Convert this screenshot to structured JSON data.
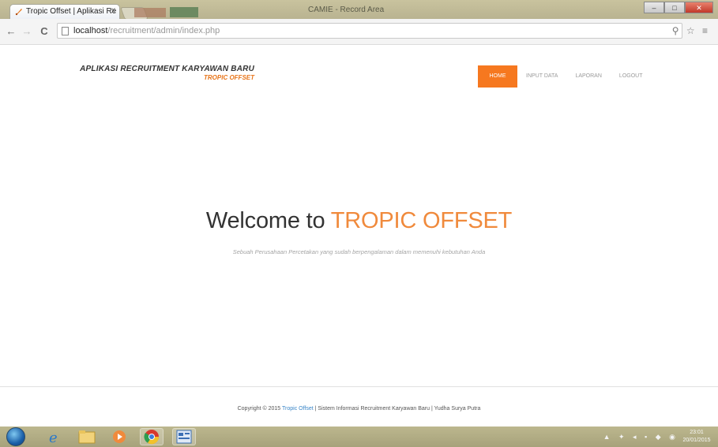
{
  "browser": {
    "tab_title": "Tropic Offset | Aplikasi Re",
    "tab_close": "x",
    "window_title": "CAMIE - Record Area",
    "url_host": "localhost",
    "url_path": "/recruitment/admin/index.php",
    "back_label": "←",
    "forward_label": "→",
    "reload_label": "C",
    "toolbar_right": "⚲ ☆ ≡",
    "window_controls": {
      "minimize": "–",
      "maximize": "□",
      "close": "✕"
    }
  },
  "header": {
    "brand_title": "APLIKASI RECRUITMENT KARYAWAN BARU",
    "brand_subtitle": "TROPIC OFFSET",
    "nav": [
      {
        "label": "HOME",
        "active": true
      },
      {
        "label": "INPUT DATA",
        "active": false
      },
      {
        "label": "LAPORAN",
        "active": false
      },
      {
        "label": "LOGOUT",
        "active": false
      }
    ]
  },
  "hero": {
    "title_prefix": "Welcome to ",
    "title_accent": "TROPIC OFFSET",
    "subtitle": "Sebuah Perusahaan Percetakan yang sudah berpengalaman dalam memenuhi kebutuhan Anda"
  },
  "footer": {
    "prefix": "Copyright © 2015 ",
    "link": "Tropic Offset",
    "suffix": " | Sistem Informasi Recruitment Karyawan Baru | Yudha Surya Putra"
  },
  "taskbar": {
    "tray_icons": "▲ ✦ ◂ ▪ ◆ ◉",
    "clock_time": "23:01",
    "clock_date": "20/01/2015"
  },
  "colors": {
    "accent": "#f6781f",
    "brand_subtitle": "#e8751a",
    "hero_accent": "#f08a3c",
    "footer_link": "#3a86c8"
  }
}
